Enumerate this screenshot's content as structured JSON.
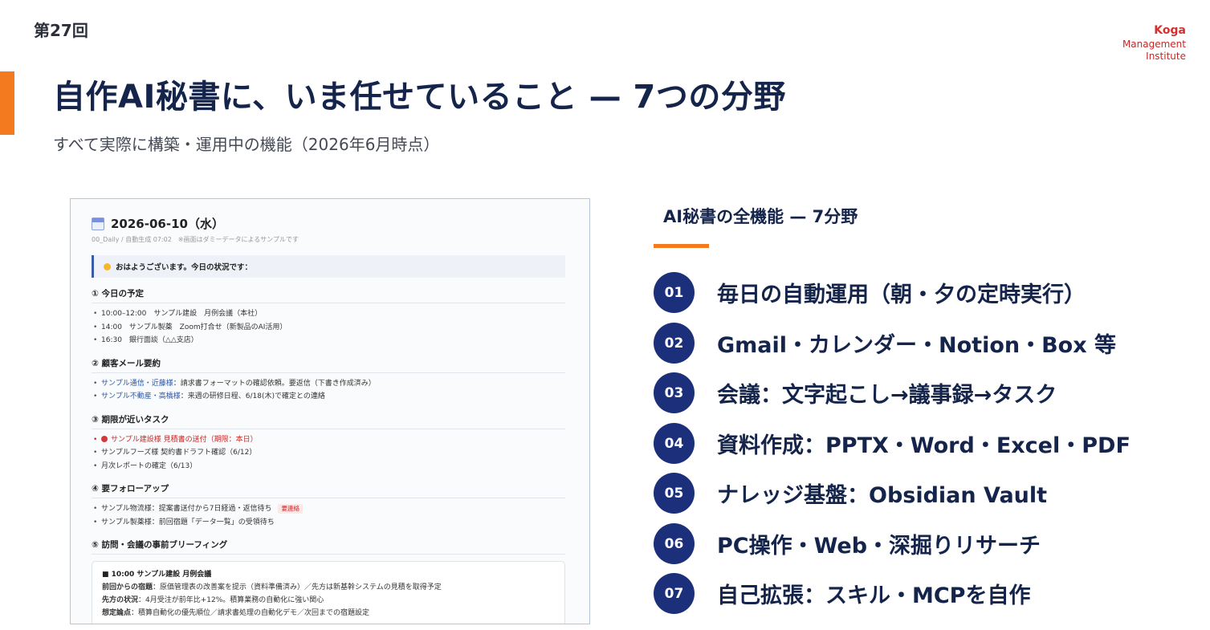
{
  "header": {
    "session": "第27回",
    "brand": [
      "Koga",
      "Management",
      "Institute"
    ],
    "title": "自作AI秘書に、いま任せていること — 7つの分野",
    "subtitle": "すべて実際に構築・運用中の機能（2026年6月時点）"
  },
  "colors": {
    "accent": "#f47a1f",
    "navy": "#14244a",
    "badge": "#1b2f7a",
    "brand": "#d32f2f"
  },
  "screenshot": {
    "date": "2026-06-10（水）",
    "meta": "00_Daily / 自動生成 07:02　※画面はダミーデータによるサンプルです",
    "greeting": "おはようございます。今日の状況です：",
    "sections": [
      {
        "title": "① 今日の予定",
        "items": [
          "10:00–12:00　サンプル建設　月例会議（本社）",
          "14:00　サンプル製薬　Zoom打合せ（新製品のAI活用）",
          "16:30　銀行面談（△△支店）"
        ]
      },
      {
        "title": "② 顧客メール要約",
        "items": [
          {
            "who": "サンプル通信・近藤様",
            "text": "：請求書フォーマットの確認依頼。要返信（下書き作成済み）"
          },
          {
            "who": "サンプル不動産・高橋様",
            "text": "：来週の研修日程、6/18(木)で確定との連絡"
          }
        ]
      },
      {
        "title": "③ 期限が近いタスク",
        "items": [
          "サンプル建設様 見積書の送付（期限：本日）",
          "サンプルフーズ様 契約書ドラフト確認（6/12）",
          "月次レポートの確定（6/13）"
        ]
      },
      {
        "title": "④ 要フォローアップ",
        "items": [
          "サンプル物流様：提案書送付から7日経過・返信待ち",
          "サンプル製薬様：前回宿題「データ一覧」の受領待ち"
        ],
        "tag": "要連絡"
      },
      {
        "title": "⑤ 訪問・会議の事前ブリーフィング"
      }
    ],
    "briefing": {
      "heading": "■ 10:00 サンプル建設 月例会議",
      "rows": [
        {
          "label": "前回からの宿題",
          "text": "：原価管理表の改善案を提示（資料準備済み）／先方は新基幹システムの見積を取得予定"
        },
        {
          "label": "先方の状況",
          "text": "：4月受注が前年比+12%。積算業務の自動化に強い関心"
        },
        {
          "label": "想定論点",
          "text": "：積算自動化の優先順位／請求書処理の自動化デモ／次回までの宿題設定"
        }
      ]
    }
  },
  "features": {
    "heading": "AI秘書の全機能 — 7分野",
    "items": [
      {
        "num": "01",
        "label": "毎日の自動運用（朝・夕の定時実行）"
      },
      {
        "num": "02",
        "label": "Gmail・カレンダー・Notion・Box 等"
      },
      {
        "num": "03",
        "label": "会議：文字起こし→議事録→タスク"
      },
      {
        "num": "04",
        "label": "資料作成：PPTX・Word・Excel・PDF"
      },
      {
        "num": "05",
        "label": "ナレッジ基盤：Obsidian Vault"
      },
      {
        "num": "06",
        "label": "PC操作・Web・深掘りリサーチ"
      },
      {
        "num": "07",
        "label": "自己拡張：スキル・MCPを自作"
      }
    ]
  }
}
